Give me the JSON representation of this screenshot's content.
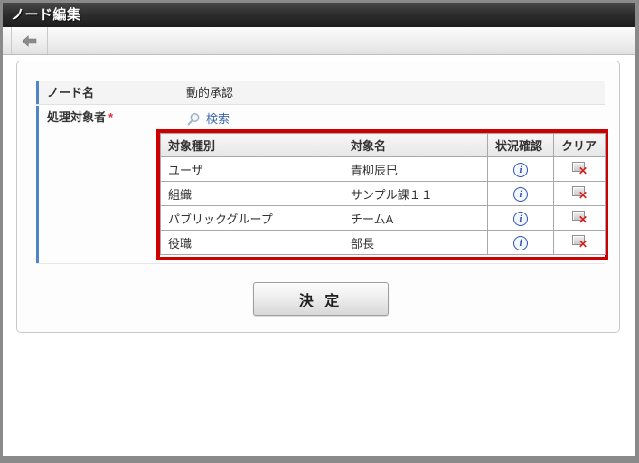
{
  "window": {
    "title": "ノード編集"
  },
  "toolbar": {
    "back_button": "back"
  },
  "icons": {
    "back": "arrow-left-icon",
    "search": "magnifier-icon",
    "status": "info-icon",
    "info_glyph": "i",
    "clear": "clear-x-icon",
    "clear_glyph": "✕"
  },
  "form": {
    "required_marker": "*",
    "fields": [
      {
        "label": "ノード名",
        "value": "動的承認",
        "required": false
      },
      {
        "label": "処理対象者",
        "required": true,
        "search_link": "検索"
      }
    ]
  },
  "table": {
    "headers": [
      "対象種別",
      "対象名",
      "状況確認",
      "クリア"
    ],
    "rows": [
      {
        "type": "ユーザ",
        "name": "青柳辰巳"
      },
      {
        "type": "組織",
        "name": "サンプル課１１"
      },
      {
        "type": "パブリックグループ",
        "name": "チームA"
      },
      {
        "type": "役職",
        "name": "部長"
      }
    ],
    "highlight_color": "#cc0000"
  },
  "actions": {
    "submit": "決 定"
  },
  "colors": {
    "accent_bar": "#4f86c6",
    "link": "#3a66ad",
    "required": "#e03131",
    "highlight": "#cc0000",
    "titlebar": "#2b2b2b"
  }
}
